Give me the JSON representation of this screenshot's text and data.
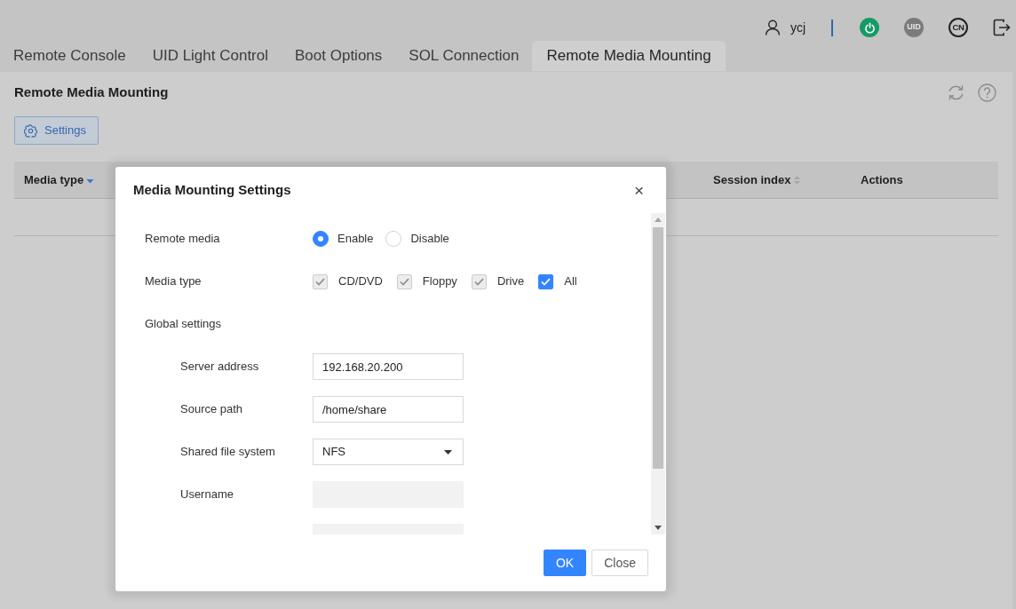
{
  "header": {
    "user": "ycj",
    "actions": [
      {
        "kind": "power"
      },
      {
        "kind": "uid",
        "label": "UID"
      },
      {
        "kind": "language",
        "label": "CN"
      },
      {
        "kind": "logout"
      }
    ]
  },
  "tabs": [
    {
      "label": "Remote Console",
      "selected": false
    },
    {
      "label": "UID Light Control",
      "selected": false
    },
    {
      "label": "Boot Options",
      "selected": false
    },
    {
      "label": "SOL Connection",
      "selected": false
    },
    {
      "label": "Remote Media Mounting",
      "selected": true
    }
  ],
  "panel": {
    "title": "Remote Media Mounting",
    "tools": [
      {
        "kind": "refresh"
      },
      {
        "kind": "help"
      }
    ],
    "settings_button": "Settings"
  },
  "table": {
    "columns": [
      {
        "label": "Media type",
        "kind": "sorted"
      },
      {
        "label": "Session index",
        "kind": "sortable"
      },
      {
        "label": "Actions",
        "kind": "plain"
      }
    ]
  },
  "dialog": {
    "title": "Media Mounting Settings",
    "close": "×",
    "rows": [
      {
        "kind": "radio",
        "label": "Remote media",
        "options": [
          {
            "label": "Enable",
            "selected": true
          },
          {
            "label": "Disable",
            "selected": false
          }
        ]
      },
      {
        "kind": "checkbox",
        "label": "Media type",
        "options": [
          {
            "label": "CD/DVD",
            "checked": true,
            "disabled": true
          },
          {
            "label": "Floppy",
            "checked": true,
            "disabled": true
          },
          {
            "label": "Drive",
            "checked": true,
            "disabled": true
          },
          {
            "label": "All",
            "checked": true,
            "disabled": false
          }
        ]
      },
      {
        "kind": "group",
        "label": "Global settings",
        "children": [
          {
            "kind": "text",
            "label": "Server address",
            "value": "192.168.20.200",
            "disabled": false
          },
          {
            "kind": "text",
            "label": "Source path",
            "value": "/home/share",
            "disabled": false
          },
          {
            "kind": "select",
            "label": "Shared file system",
            "value": "NFS",
            "disabled": false
          },
          {
            "kind": "text",
            "label": "Username",
            "disabled": true
          },
          {
            "kind": "text",
            "disabled": true,
            "cut_off": true
          }
        ]
      }
    ],
    "buttons": [
      {
        "label": "OK",
        "kind": "primary"
      },
      {
        "label": "Close",
        "kind": "secondary"
      }
    ]
  }
}
